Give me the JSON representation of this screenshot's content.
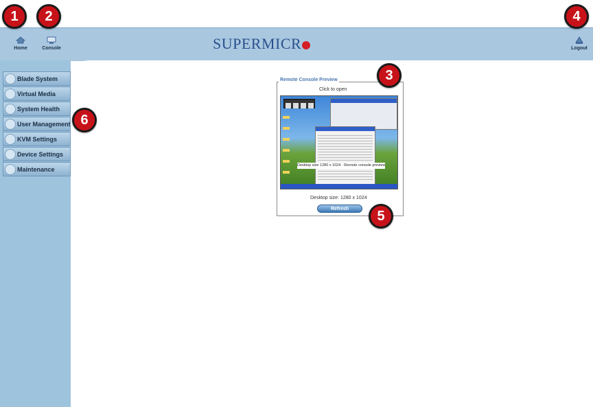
{
  "callouts": [
    "1",
    "2",
    "3",
    "4",
    "5",
    "6"
  ],
  "toolbar": {
    "home_label": "Home",
    "console_label": "Console",
    "logout_label": "Logout",
    "home_icon": "home-icon",
    "console_icon": "console-icon",
    "logout_icon": "logout-icon"
  },
  "brand": {
    "text": "SUPERMICR",
    "dot_color": "#d41f26"
  },
  "sidebar": {
    "items": [
      {
        "label": "Blade System",
        "icon": "blade-icon"
      },
      {
        "label": "Virtual Media",
        "icon": "media-icon"
      },
      {
        "label": "System Health",
        "icon": "health-icon"
      },
      {
        "label": "User Management",
        "icon": "users-icon"
      },
      {
        "label": "KVM Settings",
        "icon": "kvm-icon"
      },
      {
        "label": "Device Settings",
        "icon": "device-icon"
      },
      {
        "label": "Maintenance",
        "icon": "tools-icon"
      }
    ]
  },
  "preview": {
    "legend": "Remote Console Preview",
    "click_text": "Click to open",
    "caption": "Desktop size 1280 x 1024 · Remote console preview",
    "desktop_size": "Desktop size: 1280 x 1024",
    "refresh_label": "Refresh"
  },
  "colors": {
    "accent": "#a9c8e0",
    "sidebar": "#9ec3dd",
    "callout": "#c8121a",
    "brand": "#2b4f8c"
  }
}
